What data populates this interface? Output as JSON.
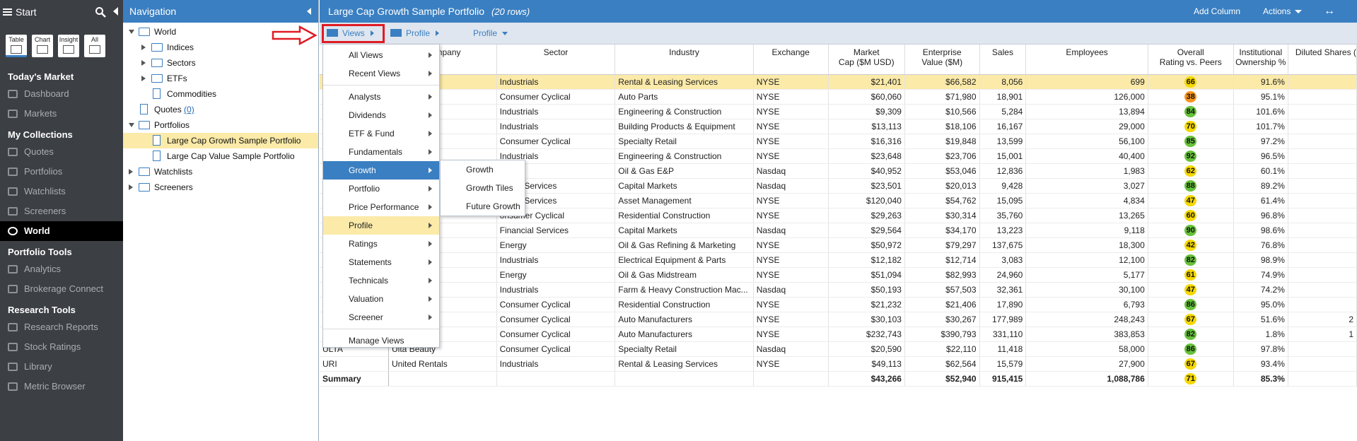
{
  "left_sidebar": {
    "start_label": "Start",
    "modes": [
      {
        "label": "Table",
        "icon": "table-icon",
        "selected": true
      },
      {
        "label": "Chart",
        "icon": "chart-icon",
        "selected": false
      },
      {
        "label": "Insight",
        "icon": "insight-icon",
        "selected": false
      },
      {
        "label": "All",
        "icon": "list-icon",
        "selected": false
      }
    ],
    "sections": [
      {
        "heading": "Today's Market",
        "items": [
          {
            "label": "Dashboard",
            "icon": "dashboard-icon"
          },
          {
            "label": "Markets",
            "icon": "markets-icon"
          }
        ]
      },
      {
        "heading": "My Collections",
        "items": [
          {
            "label": "Quotes",
            "icon": "quotes-icon"
          },
          {
            "label": "Portfolios",
            "icon": "portfolios-icon"
          },
          {
            "label": "Watchlists",
            "icon": "binoculars-icon"
          },
          {
            "label": "Screeners",
            "icon": "search-icon"
          },
          {
            "label": "World",
            "icon": "globe-icon",
            "selected": true
          }
        ]
      },
      {
        "heading": "Portfolio Tools",
        "items": [
          {
            "label": "Analytics",
            "icon": "analytics-icon"
          },
          {
            "label": "Brokerage Connect",
            "icon": "bank-icon"
          }
        ]
      },
      {
        "heading": "Research Tools",
        "items": [
          {
            "label": "Research Reports",
            "icon": "reports-icon"
          },
          {
            "label": "Stock Ratings",
            "icon": "star-icon"
          },
          {
            "label": "Library",
            "icon": "library-icon"
          },
          {
            "label": "Metric Browser",
            "icon": "metric-icon"
          }
        ]
      }
    ]
  },
  "navigation": {
    "title": "Navigation",
    "tree": [
      {
        "label": "World",
        "level": 0,
        "kind": "folder",
        "twisty": "open"
      },
      {
        "label": "Indices",
        "level": 1,
        "kind": "folder",
        "twisty": "closed"
      },
      {
        "label": "Sectors",
        "level": 1,
        "kind": "folder",
        "twisty": "closed"
      },
      {
        "label": "ETFs",
        "level": 1,
        "kind": "folder",
        "twisty": "closed"
      },
      {
        "label": "Commodities",
        "level": 1,
        "kind": "doc",
        "twisty": ""
      },
      {
        "label": "Quotes",
        "level": 0,
        "kind": "doc",
        "twisty": "",
        "count": "(0)"
      },
      {
        "label": "Portfolios",
        "level": 0,
        "kind": "folder",
        "twisty": "open"
      },
      {
        "label": "Large Cap Growth Sample Portfolio",
        "level": 1,
        "kind": "doc",
        "twisty": "",
        "selected": true
      },
      {
        "label": "Large Cap Value Sample Portfolio",
        "level": 1,
        "kind": "doc",
        "twisty": ""
      },
      {
        "label": "Watchlists",
        "level": 0,
        "kind": "folder",
        "twisty": "closed"
      },
      {
        "label": "Screeners",
        "level": 0,
        "kind": "folder",
        "twisty": "closed"
      }
    ]
  },
  "main": {
    "title": "Large Cap Growth Sample Portfolio",
    "rows_label": "(20 rows)",
    "add_column": "Add Column",
    "actions": "Actions",
    "expand_glyph": "↔",
    "toolbar": {
      "views": "Views",
      "profile_breadcrumb": "Profile",
      "profile_dropdown": "Profile"
    }
  },
  "table": {
    "columns": [
      "",
      "Company",
      "Sector",
      "Industry",
      "Exchange",
      "Market\nCap ($M USD)",
      "Enterprise\nValue ($M)",
      "Sales",
      "Employees",
      "Overall\nRating vs. Peers",
      "Institutional\nOwnership %",
      "Diluted Shares ("
    ],
    "rows": [
      {
        "sym": "",
        "company": "ldings",
        "sector": "Industrials",
        "industry": "Rental & Leasing Services",
        "exch": "NYSE",
        "mcap": "$21,401",
        "ev": "$66,582",
        "sales": "8,056",
        "emp": "699",
        "rating": "66",
        "rcolor": "#f5d800",
        "inst": "91.6%",
        "dil": "",
        "hl": true
      },
      {
        "sym": "",
        "company": "",
        "sector": "Consumer Cyclical",
        "industry": "Auto Parts",
        "exch": "NYSE",
        "mcap": "$60,060",
        "ev": "$71,980",
        "sales": "18,901",
        "emp": "126,000",
        "rating": "38",
        "rcolor": "#f7941d",
        "inst": "95.1%",
        "dil": ""
      },
      {
        "sym": "",
        "company": "",
        "sector": "Industrials",
        "industry": "Engineering & Construction",
        "exch": "NYSE",
        "mcap": "$9,309",
        "ev": "$10,566",
        "sales": "5,284",
        "emp": "13,894",
        "rating": "84",
        "rcolor": "#66c23a",
        "inst": "101.6%",
        "dil": ""
      },
      {
        "sym": "",
        "company": "stSource",
        "sector": "Industrials",
        "industry": "Building Products & Equipment",
        "exch": "NYSE",
        "mcap": "$13,113",
        "ev": "$18,106",
        "sales": "16,167",
        "emp": "29,000",
        "rating": "70",
        "rcolor": "#f5d800",
        "inst": "101.7%",
        "dil": ""
      },
      {
        "sym": "",
        "company": "ting Goods",
        "sector": "Consumer Cyclical",
        "industry": "Specialty Retail",
        "exch": "NYSE",
        "mcap": "$16,316",
        "ev": "$19,848",
        "sales": "13,599",
        "emp": "56,100",
        "rating": "85",
        "rcolor": "#66c23a",
        "inst": "97.2%",
        "dil": ""
      },
      {
        "sym": "",
        "company": "oup",
        "sector": "Industrials",
        "industry": "Engineering & Construction",
        "exch": "NYSE",
        "mcap": "$23,648",
        "ev": "$23,706",
        "sales": "15,001",
        "emp": "40,400",
        "rating": "92",
        "rcolor": "#66c23a",
        "inst": "96.5%",
        "dil": ""
      },
      {
        "sym": "",
        "company": "",
        "sector": "ergy",
        "industry": "Oil & Gas E&P",
        "exch": "Nasdaq",
        "mcap": "$40,952",
        "ev": "$53,046",
        "sales": "12,836",
        "emp": "1,983",
        "rating": "62",
        "rcolor": "#f5d800",
        "inst": "60.1%",
        "dil": ""
      },
      {
        "sym": "",
        "company": "",
        "sector": "ancial Services",
        "industry": "Capital Markets",
        "exch": "Nasdaq",
        "mcap": "$23,501",
        "ev": "$20,013",
        "sales": "9,428",
        "emp": "3,027",
        "rating": "88",
        "rcolor": "#66c23a",
        "inst": "89.2%",
        "dil": ""
      },
      {
        "sym": "",
        "company": "",
        "sector": "ancial Services",
        "industry": "Asset Management",
        "exch": "NYSE",
        "mcap": "$120,040",
        "ev": "$54,762",
        "sales": "15,095",
        "emp": "4,834",
        "rating": "47",
        "rcolor": "#f5d800",
        "inst": "61.4%",
        "dil": ""
      },
      {
        "sym": "",
        "company": "",
        "sector": "onsumer Cyclical",
        "industry": "Residential Construction",
        "exch": "NYSE",
        "mcap": "$29,263",
        "ev": "$30,314",
        "sales": "35,760",
        "emp": "13,265",
        "rating": "60",
        "rcolor": "#f5d800",
        "inst": "96.8%",
        "dil": ""
      },
      {
        "sym": "",
        "company": "dgs",
        "sector": "Financial Services",
        "industry": "Capital Markets",
        "exch": "Nasdaq",
        "mcap": "$29,564",
        "ev": "$34,170",
        "sales": "13,223",
        "emp": "9,118",
        "rating": "90",
        "rcolor": "#66c23a",
        "inst": "98.6%",
        "dil": ""
      },
      {
        "sym": "",
        "company": "etroleum",
        "sector": "Energy",
        "industry": "Oil & Gas Refining & Marketing",
        "exch": "NYSE",
        "mcap": "$50,972",
        "ev": "$79,297",
        "sales": "137,675",
        "emp": "18,300",
        "rating": "42",
        "rcolor": "#f5d800",
        "inst": "76.8%",
        "dil": ""
      },
      {
        "sym": "",
        "company": "ric",
        "sector": "Industrials",
        "industry": "Electrical Equipment & Parts",
        "exch": "NYSE",
        "mcap": "$12,182",
        "ev": "$12,714",
        "sales": "3,083",
        "emp": "12,100",
        "rating": "82",
        "rcolor": "#66c23a",
        "inst": "98.9%",
        "dil": ""
      },
      {
        "sym": "",
        "company": "",
        "sector": "Energy",
        "industry": "Oil & Gas Midstream",
        "exch": "NYSE",
        "mcap": "$51,094",
        "ev": "$82,993",
        "sales": "24,960",
        "emp": "5,177",
        "rating": "61",
        "rcolor": "#f5d800",
        "inst": "74.9%",
        "dil": ""
      },
      {
        "sym": "",
        "company": "",
        "sector": "Industrials",
        "industry": "Farm & Heavy Construction Mac...",
        "exch": "Nasdaq",
        "mcap": "$50,193",
        "ev": "$57,503",
        "sales": "32,361",
        "emp": "30,100",
        "rating": "47",
        "rcolor": "#f5d800",
        "inst": "74.2%",
        "dil": ""
      },
      {
        "sym": "",
        "company": "",
        "sector": "Consumer Cyclical",
        "industry": "Residential Construction",
        "exch": "NYSE",
        "mcap": "$21,232",
        "ev": "$21,406",
        "sales": "17,890",
        "emp": "6,793",
        "rating": "86",
        "rcolor": "#66c23a",
        "inst": "95.0%",
        "dil": ""
      },
      {
        "sym": "",
        "company": "",
        "sector": "Consumer Cyclical",
        "industry": "Auto Manufacturers",
        "exch": "NYSE",
        "mcap": "$30,103",
        "ev": "$30,267",
        "sales": "177,989",
        "emp": "248,243",
        "rating": "67",
        "rcolor": "#f5d800",
        "inst": "51.6%",
        "dil": "2"
      },
      {
        "sym": "",
        "company": "or",
        "sector": "Consumer Cyclical",
        "industry": "Auto Manufacturers",
        "exch": "NYSE",
        "mcap": "$232,743",
        "ev": "$390,793",
        "sales": "331,110",
        "emp": "383,853",
        "rating": "82",
        "rcolor": "#66c23a",
        "inst": "1.8%",
        "dil": "1"
      },
      {
        "sym": "ULTA",
        "company": "Ulta Beauty",
        "sector": "Consumer Cyclical",
        "industry": "Specialty Retail",
        "exch": "Nasdaq",
        "mcap": "$20,590",
        "ev": "$22,110",
        "sales": "11,418",
        "emp": "58,000",
        "rating": "86",
        "rcolor": "#66c23a",
        "inst": "97.8%",
        "dil": ""
      },
      {
        "sym": "URI",
        "company": "United Rentals",
        "sector": "Industrials",
        "industry": "Rental & Leasing Services",
        "exch": "NYSE",
        "mcap": "$49,113",
        "ev": "$62,564",
        "sales": "15,579",
        "emp": "27,900",
        "rating": "67",
        "rcolor": "#f5d800",
        "inst": "93.4%",
        "dil": ""
      }
    ],
    "summary": {
      "label": "Summary",
      "mcap": "$43,266",
      "ev": "$52,940",
      "sales": "915,415",
      "emp": "1,088,786",
      "rating": "71",
      "rcolor": "#f5d800",
      "inst": "85.3%"
    }
  },
  "views_menu": {
    "items": [
      {
        "label": "All Views",
        "arrow": true
      },
      {
        "label": "Recent Views",
        "arrow": true
      },
      {
        "sep": true
      },
      {
        "label": "Analysts",
        "arrow": true
      },
      {
        "label": "Dividends",
        "arrow": true
      },
      {
        "label": "ETF & Fund",
        "arrow": true
      },
      {
        "label": "Fundamentals",
        "arrow": true
      },
      {
        "label": "Growth",
        "arrow": true,
        "state": "hover"
      },
      {
        "label": "Portfolio",
        "arrow": true
      },
      {
        "label": "Price Performance",
        "arrow": true
      },
      {
        "label": "Profile",
        "arrow": true,
        "state": "current"
      },
      {
        "label": "Ratings",
        "arrow": true
      },
      {
        "label": "Statements",
        "arrow": true
      },
      {
        "label": "Technicals",
        "arrow": true
      },
      {
        "label": "Valuation",
        "arrow": true
      },
      {
        "label": "Screener",
        "arrow": true
      },
      {
        "sep": true
      },
      {
        "label": "Manage Views",
        "arrow": false
      }
    ]
  },
  "growth_submenu": {
    "items": [
      "Growth",
      "Growth Tiles",
      "Future Growth"
    ]
  },
  "colors": {
    "accent": "#3a7fc1",
    "highlight": "#fbeaa8",
    "sidebar": "#3c3f44",
    "annotation": "#e01b24"
  }
}
